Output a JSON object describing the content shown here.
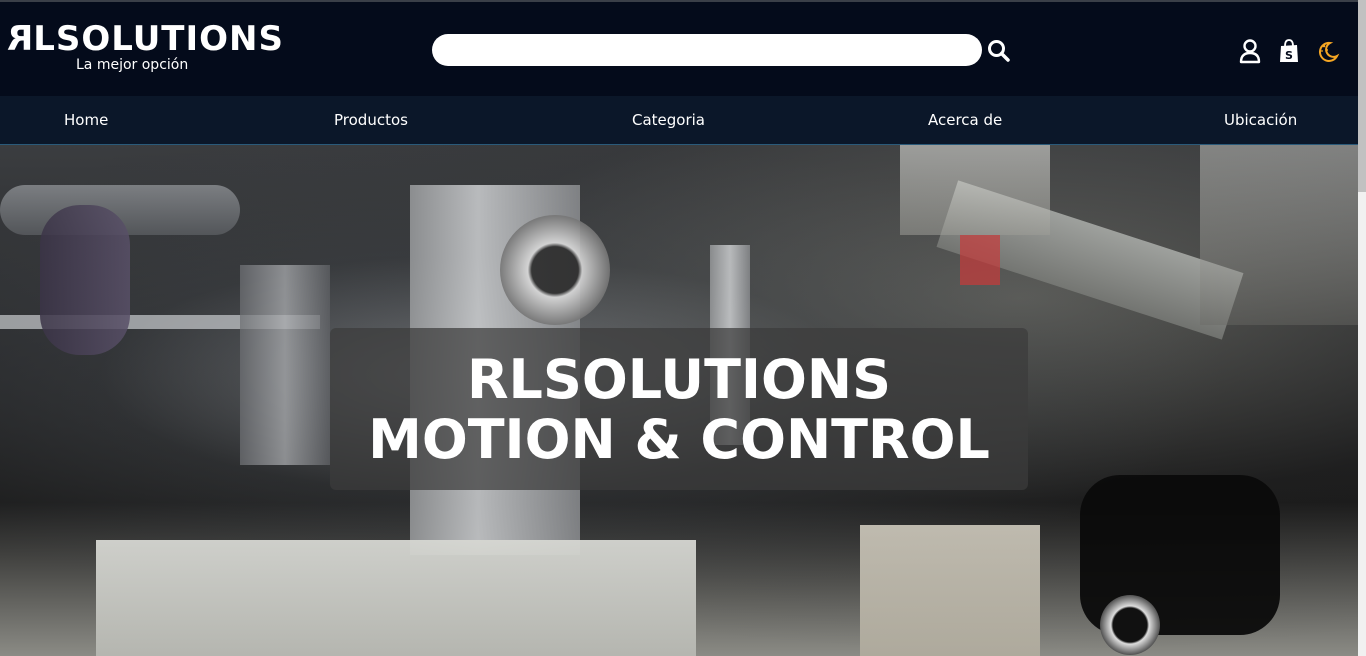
{
  "header": {
    "logo_r": "R",
    "logo_rest": "LSOLUTIONS",
    "tagline": "La mejor opción",
    "search": {
      "placeholder": "",
      "value": ""
    },
    "icons": [
      "search-icon",
      "user-icon",
      "shopping-bag-icon",
      "moon-stars-icon"
    ],
    "colors": {
      "background": "#040b1b",
      "moon_icon": "#f5a623"
    }
  },
  "nav": {
    "items": [
      {
        "label": "Home"
      },
      {
        "label": "Productos"
      },
      {
        "label": "Categoria"
      },
      {
        "label": "Acerca de"
      },
      {
        "label": "Ubicación"
      }
    ],
    "colors": {
      "background": "#0b1729"
    }
  },
  "hero": {
    "title_line1": "RLSOLUTIONS",
    "title_line2": "MOTION & CONTROL"
  }
}
